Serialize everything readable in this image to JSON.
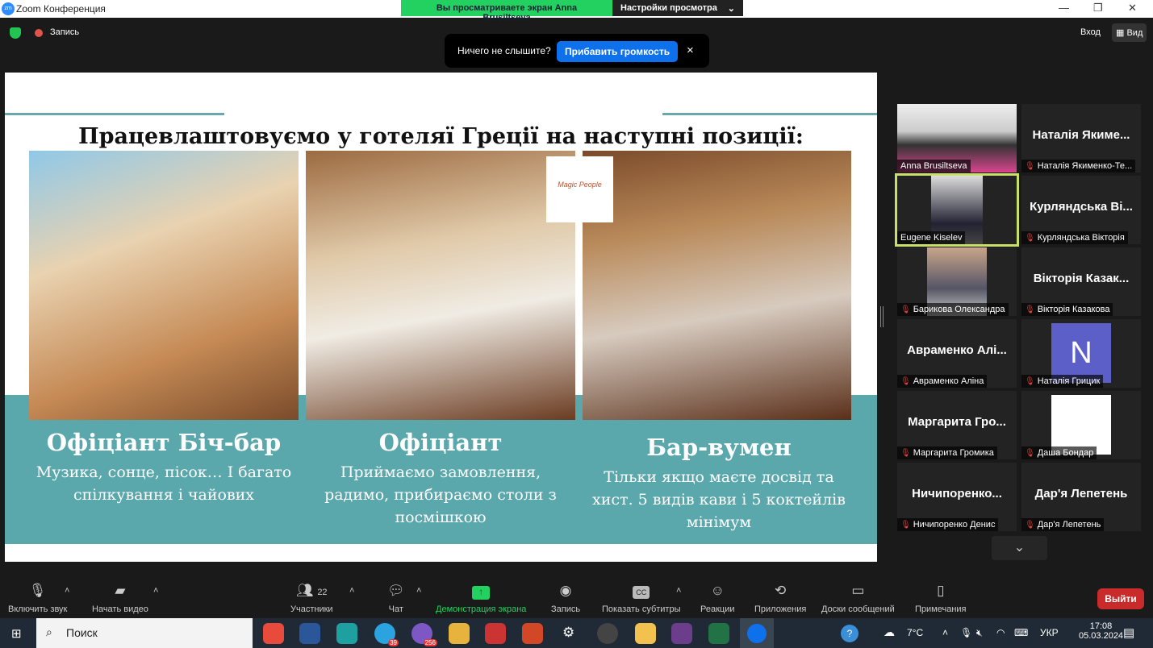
{
  "window": {
    "title": "Zoom Конференция",
    "logo_text": "zm"
  },
  "share_banner": {
    "viewing": "Вы просматриваете экран Anna Brusiltseva",
    "view_settings": "Настройки просмотра"
  },
  "topbar": {
    "recording": "Запись",
    "signin": "Вход",
    "view": "Вид"
  },
  "notification": {
    "text": "Ничего не слышите?",
    "button": "Прибавить громкость",
    "close": "×"
  },
  "slide": {
    "title": "Працевлаштовуємо у готеляї Греції на наступні позиції:",
    "logo": "Magic People",
    "positions": [
      {
        "title": "Офіціант Біч-бар",
        "desc": "Музика, сонце, пісок… І багато спілкування і чайових"
      },
      {
        "title": "Офіціант",
        "desc": "Приймаємо замовлення, радимо, прибираємо столи з посмішкою"
      },
      {
        "title": "Бар-вумен",
        "desc": "Тільки якщо маєте досвід та хист. 5 видів кави і 5 коктейлів мінімум"
      }
    ],
    "colors": {
      "teal": "#5aa7ac"
    }
  },
  "participants": [
    {
      "big": "",
      "name": "Anna Brusiltseva",
      "video": true,
      "muted": false
    },
    {
      "big": "Наталія Якиме...",
      "name": "Наталія Якименко-Те...",
      "muted": true
    },
    {
      "big": "",
      "name": "Eugene Kiselev",
      "video": true,
      "muted": false,
      "active": true
    },
    {
      "big": "Курляндська Ві...",
      "name": "Курляндська Вікторія",
      "muted": true
    },
    {
      "big": "",
      "name": "Барикова Олександра",
      "video": true,
      "muted": true
    },
    {
      "big": "Вікторія Казак...",
      "name": "Вікторія Казакова",
      "muted": true
    },
    {
      "big": "Авраменко Алі...",
      "name": "Авраменко Аліна",
      "muted": true
    },
    {
      "big": "N",
      "name": "Наталія Грицик",
      "muted": true,
      "avatar": true
    },
    {
      "big": "Маргарита Гро...",
      "name": "Маргарита Громика",
      "muted": true
    },
    {
      "big": "",
      "name": "Даша Бондар",
      "muted": true,
      "white": true
    },
    {
      "big": "Ничипоренко...",
      "name": "Ничипоренко Денис",
      "muted": true
    },
    {
      "big": "Дар'я Лепетень",
      "name": "Дар'я Лепетень",
      "muted": true
    }
  ],
  "toolbar": {
    "unmute": "Включить звук",
    "video": "Начать видео",
    "participants": "Участники",
    "participants_count": "22",
    "chat": "Чат",
    "share": "Демонстрация экрана",
    "record": "Запись",
    "captions": "Показать субтитры",
    "reactions": "Реакции",
    "apps": "Приложения",
    "whiteboards": "Доски сообщений",
    "notes": "Примечания",
    "leave": "Выйти"
  },
  "taskbar": {
    "search": "Поиск",
    "weather": "7°C",
    "lang": "УКР",
    "time": "17:08",
    "date": "05.03.2024",
    "telegram_badge": "39",
    "viber_badge": "256"
  }
}
